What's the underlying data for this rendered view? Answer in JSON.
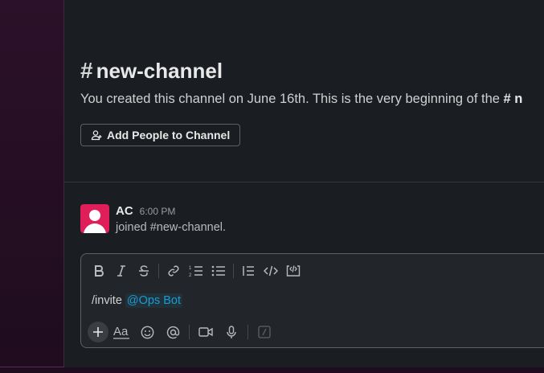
{
  "channel": {
    "hash": "#",
    "name": "new-channel",
    "intro_text": "You created this channel on June 16th. This is the very beginning of the ",
    "intro_channel_ref": "# n",
    "add_people_label": "Add People to Channel"
  },
  "message": {
    "author": "AC",
    "time": "6:00 PM",
    "text": "joined #new-channel."
  },
  "composer": {
    "command": "/invite ",
    "mention": "@Ops Bot"
  },
  "colors": {
    "sidebar": "#2b1129",
    "background": "#1a1d21",
    "avatar": "#e01e5a",
    "mention": "#1d9bd1"
  },
  "icons": {
    "formatting": [
      "bold-icon",
      "italic-icon",
      "strikethrough-icon",
      "link-icon",
      "ordered-list-icon",
      "bulleted-list-icon",
      "blockquote-icon",
      "code-icon",
      "code-block-icon"
    ],
    "bottom": [
      "plus-icon",
      "text-format-icon",
      "emoji-icon",
      "mention-icon",
      "video-icon",
      "microphone-icon",
      "slash-command-icon"
    ]
  }
}
